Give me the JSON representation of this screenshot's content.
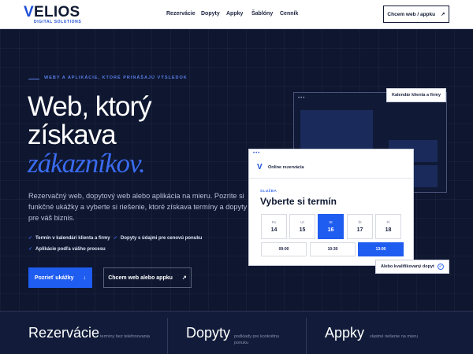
{
  "header": {
    "logo_mark": "V",
    "logo_word": "ELIOS",
    "logo_tagline": "DIGITAL SOLUTIONS",
    "nav": [
      "Rezervácie",
      "Dopyty",
      "Appky",
      "Šablóny",
      "Cenník"
    ],
    "cta_label": "Chcem web / appku",
    "cta_arrow": "↗"
  },
  "hero": {
    "eyebrow": "WEBY A APLIKÁCIE, KTORÉ PRINÁŠAJÚ VÝSLEDOK",
    "title_line1": "Web, ktorý",
    "title_line2": "získava",
    "title_line3": "zákazníkov.",
    "lead_lines": [
      "Rezervačný web, dopytový web alebo aplikácia na mieru. Pozrite si",
      "funkčné ukážky a vyberte si riešenie, ktoré získava termíny a dopyty",
      "pre váš biznis."
    ],
    "features": [
      "Termín v kalendári klienta a firmy",
      "Dopyty s údajmi pre cenovú ponuku",
      "Aplikácie podľa vášho procesu"
    ],
    "check_glyph": "✓",
    "primary_button": "Pozrieť ukážky",
    "primary_arrow": "↓",
    "secondary_button": "Chcem web alebo appku",
    "secondary_arrow": "↗"
  },
  "mockup": {
    "calendar_tag": "Kalendár klienta a firmy",
    "window_dots": "•••",
    "card_logo": "V",
    "card_title": "Online rezervácia",
    "label": "SLUŽBA",
    "heading": "Vyberte si termín",
    "days": [
      {
        "name": "Po",
        "date": "14"
      },
      {
        "name": "Ut",
        "date": "15"
      },
      {
        "name": "St",
        "date": "16"
      },
      {
        "name": "Št",
        "date": "17"
      },
      {
        "name": "Pi",
        "date": "18"
      }
    ],
    "active_day": "16",
    "slots": [
      "09:00",
      "10:30",
      "13:00"
    ],
    "active_slot": "13:00",
    "qualified_tag": "Alebo kvalifikovaný dopyt",
    "qualified_check": "✓"
  },
  "bottom": [
    {
      "title": "Rezervácie",
      "desc": "termíny bez telefonovania"
    },
    {
      "title": "Dopyty",
      "desc": "podklady pre konkrétnu ponuku"
    },
    {
      "title": "Appky",
      "desc": "vlastné riešenie na mieru"
    }
  ],
  "colors": {
    "background": "#0e1630",
    "accent": "#1f5cf0",
    "brand": "#1f4fd8"
  }
}
